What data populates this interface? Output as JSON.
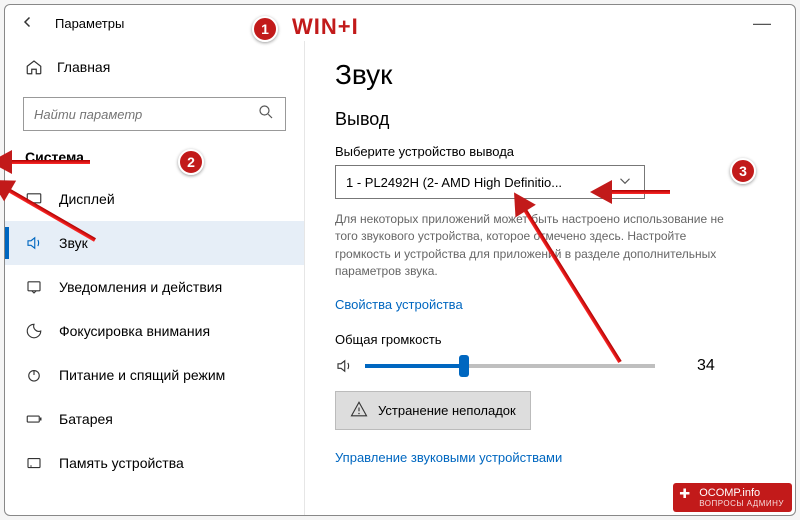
{
  "window": {
    "title": "Параметры"
  },
  "sidebar": {
    "home": "Главная",
    "search_placeholder": "Найти параметр",
    "section": "Система",
    "items": [
      {
        "label": "Дисплей"
      },
      {
        "label": "Звук"
      },
      {
        "label": "Уведомления и действия"
      },
      {
        "label": "Фокусировка внимания"
      },
      {
        "label": "Питание и спящий режим"
      },
      {
        "label": "Батарея"
      },
      {
        "label": "Память устройства"
      }
    ]
  },
  "main": {
    "heading": "Звук",
    "output_heading": "Вывод",
    "output_label": "Выберите устройство вывода",
    "output_device": "1 - PL2492H (2- AMD High Definitio...",
    "output_desc": "Для некоторых приложений может быть настроено использование не того звукового устройства, которое отмечено здесь. Настройте громкость и устройства для приложений в разделе дополнительных параметров звука.",
    "device_props": "Свойства устройства",
    "volume_label": "Общая громкость",
    "volume_value": "34",
    "troubleshoot": "Устранение неполадок",
    "manage_devices": "Управление звуковыми устройствами"
  },
  "annotations": {
    "b1": "1",
    "b2": "2",
    "b3": "3",
    "hotkey": "WIN+I"
  },
  "watermark": {
    "site": "OCOMP.info",
    "sub": "ВОПРОСЫ АДМИНУ"
  }
}
